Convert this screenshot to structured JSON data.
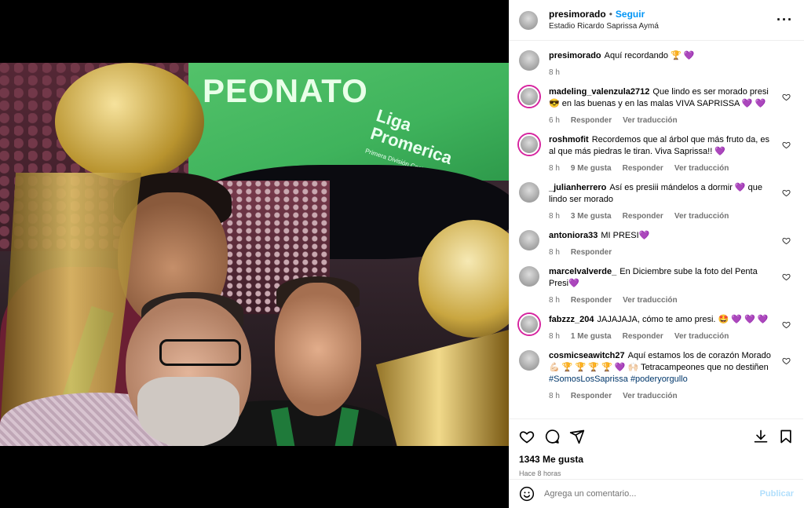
{
  "post": {
    "username": "presimorado",
    "follow_label": "Seguir",
    "location": "Estadio Ricardo Saprissa Aymá",
    "photo_banner": {
      "headline": "PEONATO",
      "liga_line1": "Liga",
      "liga_line2": "Promerica",
      "liga_sub": "Primera División Costa Rica"
    },
    "caption": {
      "username": "presimorado",
      "text": "Aquí recordando 🏆 💜",
      "time": "8 h"
    },
    "likes": "1343 Me gusta",
    "time_ago": "Hace 8 horas"
  },
  "comments": [
    {
      "user": "madeling_valenzula2712",
      "text": "Que lindo es ser morado presi😎 en las buenas y en las malas VIVA SAPRISSA 💜 💜",
      "time": "6 h",
      "likes": "",
      "reply": "Responder",
      "translate": "Ver traducción"
    },
    {
      "user": "roshmofit",
      "text": "Recordemos que al árbol que más fruto da, es al que más piedras le tiran. Viva Saprissa!! 💜",
      "time": "8 h",
      "likes": "9 Me gusta",
      "reply": "Responder",
      "translate": "Ver traducción"
    },
    {
      "user": "_julianherrero",
      "text": "Así es presiii mándelos a dormir 💜 que lindo ser morado",
      "time": "8 h",
      "likes": "3 Me gusta",
      "reply": "Responder",
      "translate": "Ver traducción"
    },
    {
      "user": "antoniora33",
      "text": "MI PRESI💜",
      "time": "8 h",
      "likes": "",
      "reply": "Responder",
      "translate": ""
    },
    {
      "user": "marcelvalverde_",
      "text": "En Diciembre sube la foto del Penta Presi💜",
      "time": "8 h",
      "likes": "",
      "reply": "Responder",
      "translate": "Ver traducción"
    },
    {
      "user": "fabzzz_204",
      "text": "JAJAJAJA, cómo te amo presi. 🤩 💜 💜 💜",
      "time": "8 h",
      "likes": "1 Me gusta",
      "reply": "Responder",
      "translate": "Ver traducción"
    },
    {
      "user": "cosmicseawitch27",
      "text": "Aquí estamos los de corazón Morado 💪🏻 🏆 🏆 🏆 🏆 💜 🙌🏻 Tetracampeones que no destiñen",
      "tags": "#SomosLosSaprissa #poderyorgullo",
      "time": "8 h",
      "likes": "",
      "reply": "Responder",
      "translate": "Ver traducción"
    }
  ],
  "composer": {
    "placeholder": "Agrega un comentario...",
    "publish_label": "Publicar"
  },
  "colors": {
    "link_blue": "#0095f6",
    "hashtag": "#00376b",
    "muted": "#737373",
    "publish_disabled": "#b2dffc"
  }
}
